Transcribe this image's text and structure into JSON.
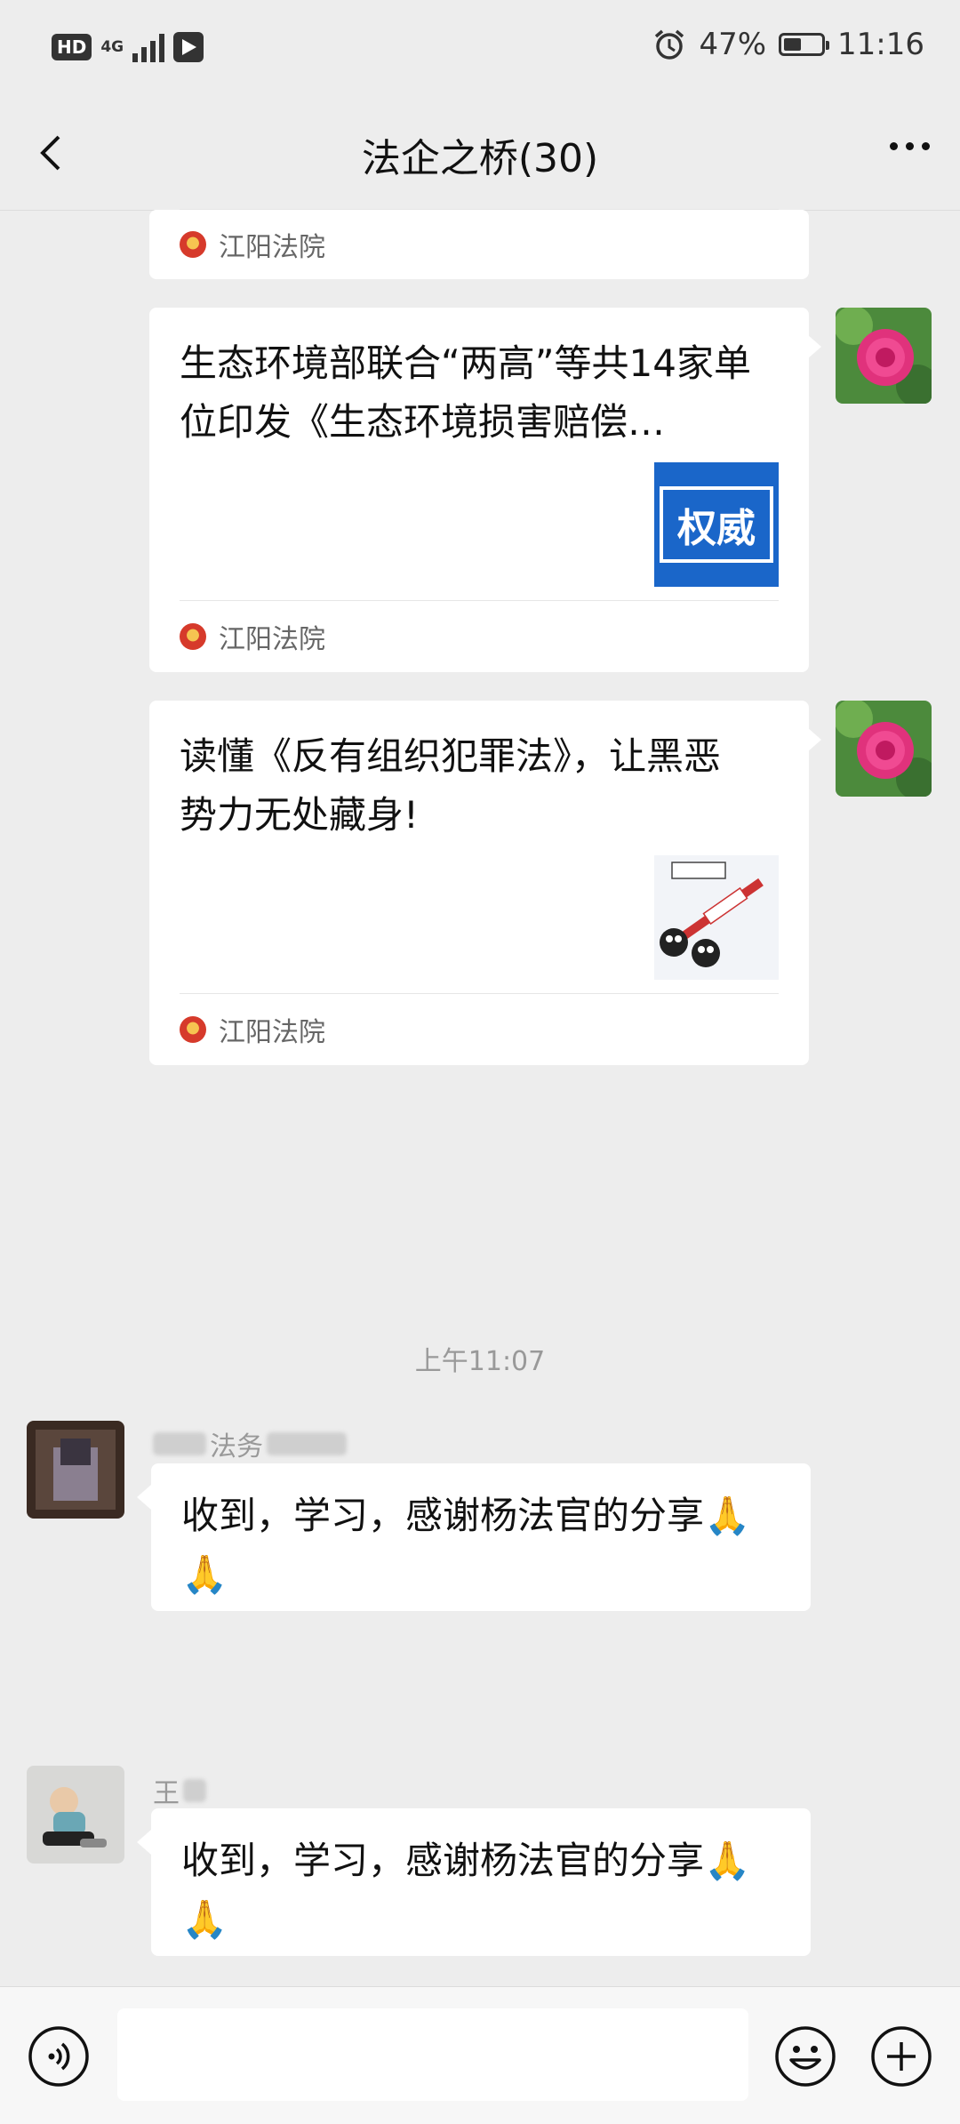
{
  "status_bar": {
    "hd": "HD",
    "network": "4G",
    "battery": "47%",
    "battery_level": 0.47,
    "time": "11:16"
  },
  "header": {
    "title": "法企之桥(30)"
  },
  "messages": [
    {
      "type": "link_card_partial",
      "source": "江阳法院"
    },
    {
      "type": "link_card",
      "title": "生态环境部联合“两高”等共14家单位印发《生态环境损害赔偿…",
      "thumb_text": "权威",
      "source": "江阳法院",
      "color": "#1a66c9"
    },
    {
      "type": "link_card",
      "title": "读懂《反有组织犯罪法》，让黑恶势力无处藏身!",
      "source": "江阳法院"
    }
  ],
  "time_separator": "上午11:07",
  "chats": [
    {
      "sender_visible": "法务",
      "text": "收到，学习，感谢杨法官的分享",
      "emoji": "🙏🙏"
    },
    {
      "sender_visible": "王",
      "text": "收到，学习，感谢杨法官的分享",
      "emoji": "🙏🙏"
    }
  ],
  "input_bar": {
    "voice_icon": "voice-icon",
    "emoji_icon": "emoji-icon",
    "plus_icon": "plus-icon"
  }
}
